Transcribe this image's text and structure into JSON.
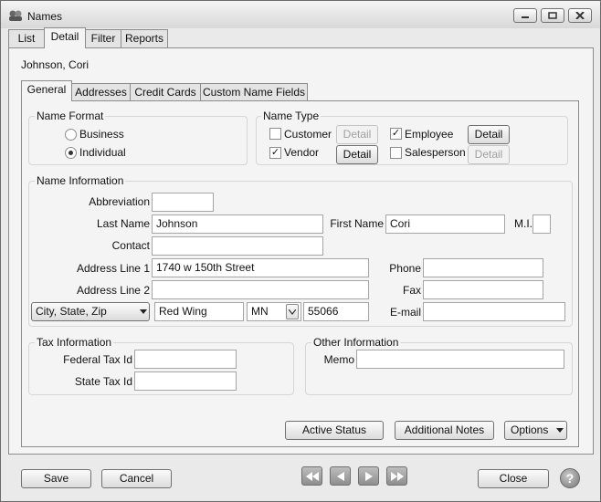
{
  "window": {
    "title": "Names",
    "controls": {
      "minimize_icon": "minimize-icon",
      "maximize_icon": "maximize-icon",
      "close_icon": "close-icon"
    }
  },
  "top_tabs": [
    "List",
    "Detail",
    "Filter",
    "Reports"
  ],
  "record_name": "Johnson, Cori",
  "detail_tabs": [
    "General",
    "Addresses",
    "Credit Cards",
    "Custom Name Fields"
  ],
  "name_format": {
    "legend": "Name Format",
    "options": [
      {
        "label": "Business",
        "selected": false
      },
      {
        "label": "Individual",
        "selected": true
      }
    ]
  },
  "name_type": {
    "legend": "Name Type",
    "items": [
      {
        "label": "Customer",
        "checked": false,
        "detail": "Detail",
        "detail_enabled": false
      },
      {
        "label": "Employee",
        "checked": true,
        "detail": "Detail",
        "detail_enabled": true
      },
      {
        "label": "Vendor",
        "checked": true,
        "detail": "Detail",
        "detail_enabled": true
      },
      {
        "label": "Salesperson",
        "checked": false,
        "detail": "Detail",
        "detail_enabled": false
      }
    ]
  },
  "name_information": {
    "legend": "Name Information",
    "abbreviation": {
      "label": "Abbreviation",
      "value": ""
    },
    "last_name": {
      "label": "Last Name",
      "value": "Johnson"
    },
    "first_name": {
      "label": "First Name",
      "value": "Cori"
    },
    "mi": {
      "label": "M.I.",
      "value": ""
    },
    "contact": {
      "label": "Contact",
      "value": ""
    },
    "address1": {
      "label": "Address Line 1",
      "value": "1740 w 150th Street"
    },
    "address2": {
      "label": "Address Line 2",
      "value": ""
    },
    "phone": {
      "label": "Phone",
      "value": ""
    },
    "fax": {
      "label": "Fax",
      "value": ""
    },
    "email": {
      "label": "E-mail",
      "value": ""
    },
    "csz_select": "City, State, Zip",
    "city": "Red Wing",
    "state": "MN",
    "zip": "55066"
  },
  "tax_information": {
    "legend": "Tax Information",
    "federal": {
      "label": "Federal Tax Id",
      "value": ""
    },
    "state": {
      "label": "State Tax Id",
      "value": ""
    }
  },
  "other_information": {
    "legend": "Other Information",
    "memo": {
      "label": "Memo",
      "value": ""
    }
  },
  "actions": {
    "active_status": "Active Status",
    "additional_notes": "Additional Notes",
    "options": "Options"
  },
  "footer": {
    "save": "Save",
    "cancel": "Cancel",
    "close": "Close"
  },
  "icons": {
    "app": "names-app-icon",
    "nav": [
      "first-record-icon",
      "previous-record-icon",
      "next-record-icon",
      "last-record-icon"
    ],
    "help": "help-icon",
    "dropdown": "chevron-down-icon"
  },
  "colors": {
    "window_bg": "#eaeaea",
    "panel_bg": "#f4f4f4",
    "nav_button": "#9a9a9a"
  }
}
